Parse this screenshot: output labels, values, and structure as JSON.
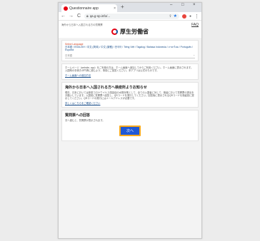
{
  "browser": {
    "tab_title": "Questionnaire app",
    "tab_close": "×",
    "new_tab": "+",
    "minimize": "–",
    "maximize": "□",
    "close": "×",
    "back": "←",
    "forward": "→",
    "reload": "C",
    "url": "qa.g-sp.info/...",
    "more": "⋮"
  },
  "page": {
    "top_note": "海外から日本へ入国される方の質問票",
    "faq": "FAQ",
    "logo_text": "厚生労働省"
  },
  "language": {
    "title": "Select Language",
    "list": "日本語 / ENGLISH / 中文 (简体) / 中文 (繁體) / 한국어 / Tiếng Việt / Tagalog / Bahasa Indonesia / ภาษาไทย / Português / Español",
    "selected": "日本語",
    "chevron": "⌄"
  },
  "intro": {
    "text": "ホームページ（website, app）をご利用の方は、ホーム画面へ追加してからご利用ください。ホーム画面に表示されます。入国時の手続きが円滑に進むよう、事前にご回答ください。本アプリは公式のものです。",
    "link": "ホーム画面への追加方法"
  },
  "notice": {
    "heading": "海外から日本へ入国される方へ検疫所よりお知らせ",
    "text": "現在、日本においては新型コロナウイルス感染症の水際対策として、全ての入国者に対して、検疫において質問票の提出をお願いしています。入国前に質問票へ回答し、QRコードを発行してください。回答後に表示されるQRコードを検疫官に提示してください。QRコードの発行にはメールアドレスが必要です。",
    "link": "詳しくはこちらをご確認ください"
  },
  "questionnaire": {
    "heading": "質問票への回答",
    "text": "次へ進むと、質問票が表示されます。",
    "next_label": "次へ"
  }
}
